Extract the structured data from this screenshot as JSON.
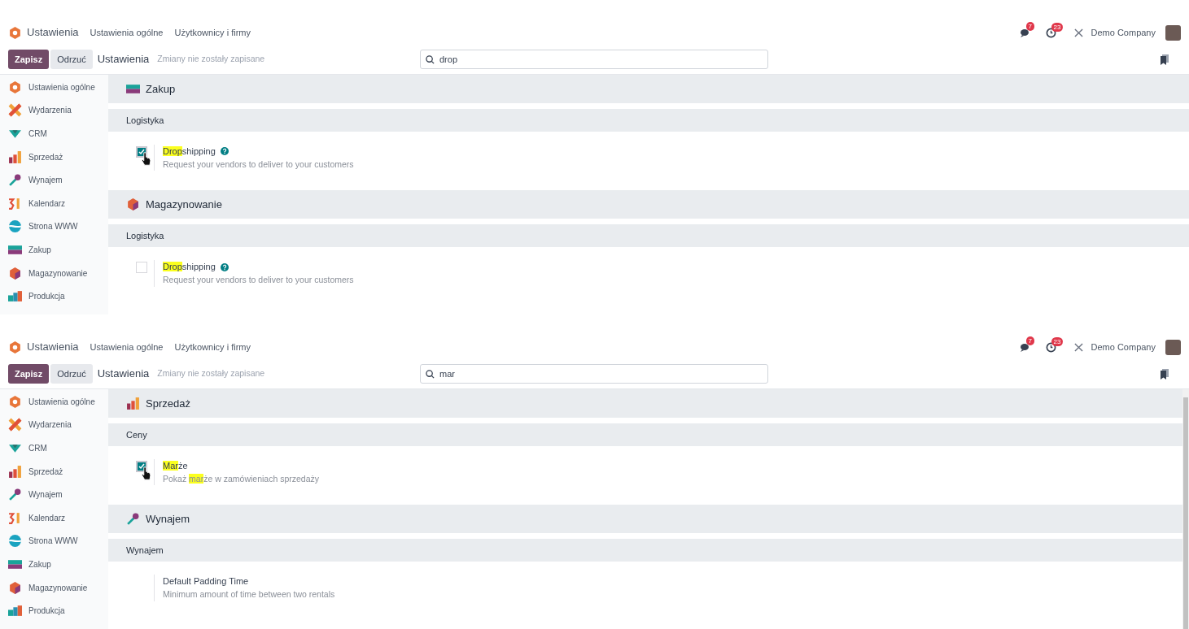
{
  "panels": [
    {
      "nav": {
        "app": "Ustawienia",
        "menu": [
          "Ustawienia ogólne",
          "Użytkownicy i firmy"
        ],
        "messages_badge": "7",
        "activities_badge": "23",
        "company": "Demo Company"
      },
      "control": {
        "save": "Zapisz",
        "discard": "Odrzuć",
        "title": "Ustawienia",
        "status": "Zmiany nie zostały zapisane",
        "search": "drop"
      },
      "sidebar": [
        {
          "label": "Ustawienia ogólne",
          "selected": false
        },
        {
          "label": "Wydarzenia",
          "selected": false
        },
        {
          "label": "CRM",
          "selected": false
        },
        {
          "label": "Sprzedaż",
          "selected": false
        },
        {
          "label": "Wynajem",
          "selected": false
        },
        {
          "label": "Kalendarz",
          "selected": false
        },
        {
          "label": "Strona WWW",
          "selected": false
        },
        {
          "label": "Zakup",
          "selected": false
        },
        {
          "label": "Magazynowanie",
          "selected": false
        },
        {
          "label": "Produkcja",
          "selected": false
        }
      ],
      "scrollable": false,
      "sections": [
        {
          "title": "Zakup",
          "kind": "purchase",
          "groups": [
            {
              "title": "Logistyka",
              "settings": [
                {
                  "kind": "checkbox",
                  "checked": true,
                  "pointer": true,
                  "help": true,
                  "title": [
                    {
                      "text": "Drop",
                      "highlight": true
                    },
                    {
                      "text": "shipping",
                      "highlight": false
                    }
                  ],
                  "description": [
                    {
                      "text": "Request your vendors to deliver to your customers",
                      "highlight": false
                    }
                  ]
                }
              ]
            }
          ]
        },
        {
          "title": "Magazynowanie",
          "kind": "inventory",
          "groups": [
            {
              "title": "Logistyka",
              "settings": [
                {
                  "kind": "checkbox",
                  "checked": false,
                  "pointer": false,
                  "help": true,
                  "title": [
                    {
                      "text": "Drop",
                      "highlight": true
                    },
                    {
                      "text": "shipping",
                      "highlight": false
                    }
                  ],
                  "description": [
                    {
                      "text": "Request your vendors to deliver to your customers",
                      "highlight": false
                    }
                  ]
                }
              ]
            }
          ]
        }
      ]
    },
    {
      "nav": {
        "app": "Ustawienia",
        "menu": [
          "Ustawienia ogólne",
          "Użytkownicy i firmy"
        ],
        "messages_badge": "7",
        "activities_badge": "23",
        "company": "Demo Company"
      },
      "control": {
        "save": "Zapisz",
        "discard": "Odrzuć",
        "title": "Ustawienia",
        "status": "Zmiany nie zostały zapisane",
        "search": "mar"
      },
      "sidebar": [
        {
          "label": "Ustawienia ogólne",
          "selected": false
        },
        {
          "label": "Wydarzenia",
          "selected": false
        },
        {
          "label": "CRM",
          "selected": false
        },
        {
          "label": "Sprzedaż",
          "selected": false
        },
        {
          "label": "Wynajem",
          "selected": false
        },
        {
          "label": "Kalendarz",
          "selected": false
        },
        {
          "label": "Strona WWW",
          "selected": false
        },
        {
          "label": "Zakup",
          "selected": false
        },
        {
          "label": "Magazynowanie",
          "selected": false
        },
        {
          "label": "Produkcja",
          "selected": false
        }
      ],
      "scrollable": true,
      "sections": [
        {
          "title": "Sprzedaż",
          "kind": "sales",
          "groups": [
            {
              "title": "Ceny",
              "settings": [
                {
                  "kind": "checkbox",
                  "checked": true,
                  "pointer": true,
                  "help": false,
                  "title": [
                    {
                      "text": "Mar",
                      "highlight": true
                    },
                    {
                      "text": "że",
                      "highlight": false
                    }
                  ],
                  "description": [
                    {
                      "text": "Pokaż ",
                      "highlight": false
                    },
                    {
                      "text": "mar",
                      "highlight": true
                    },
                    {
                      "text": "że w zamówieniach sprzedaży",
                      "highlight": false
                    }
                  ]
                }
              ]
            }
          ]
        },
        {
          "title": "Wynajem",
          "kind": "rental",
          "groups": [
            {
              "title": "Wynajem",
              "settings": [
                {
                  "kind": "plain",
                  "pointer": false,
                  "help": false,
                  "title": [
                    {
                      "text": "Default Padding Time",
                      "highlight": false
                    }
                  ],
                  "description": [
                    {
                      "text": "Minimum amount of time between two rentals",
                      "highlight": false
                    }
                  ]
                }
              ]
            }
          ]
        }
      ]
    }
  ]
}
